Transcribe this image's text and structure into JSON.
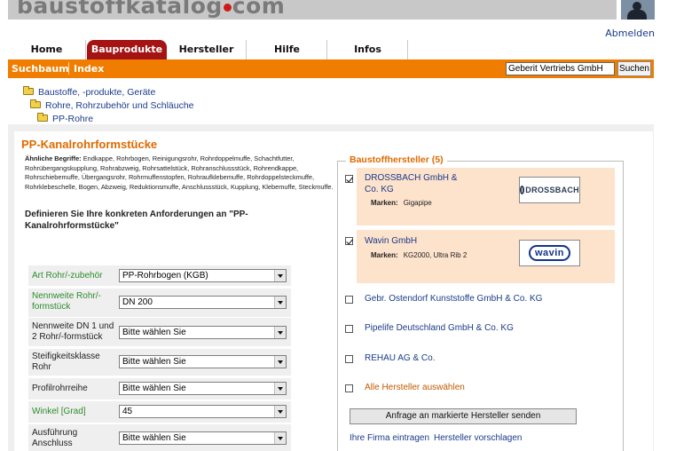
{
  "header": {
    "logo_text": "baustoffkatalog",
    "logo_suffix": "com",
    "logout_label": "Abmelden"
  },
  "tabs": [
    {
      "label": "Home",
      "active": false
    },
    {
      "label": "Bauprodukte",
      "active": true
    },
    {
      "label": "Hersteller",
      "active": false
    },
    {
      "label": "Hilfe",
      "active": false
    },
    {
      "label": "Infos",
      "active": false
    }
  ],
  "subnav": {
    "suchbaum": "Suchbaum",
    "index": "Index",
    "search_value": "Geberit Vertriebs GmbH",
    "search_button": "Suchen"
  },
  "breadcrumb": [
    "Baustoffe, -produkte, Geräte",
    "Rohre, Rohrzubehör und Schläuche",
    "PP-Rohre"
  ],
  "main": {
    "title": "PP-Kanalrohrformstücke",
    "similar_label": "Ähnliche Begriffe:",
    "similar_terms": "Endkappe, Rohrbogen, Reinigungsrohr, Rohrdoppelmuffe, Schachtfutter, Rohrübergangskupplung, Rohrabzweig, Rohrsattelstück, Rohranschlussstück, Rohrendkappe, Rohrschiebemuffe, Übergangsrohr, Rohrmuffenstopfen, Rohraufklebemuffe, Rohrdoppelsteckmuffe, Rohrklebeschelle, Bogen, Abzweig, Reduktionsmuffe, Anschlussstück, Kupplung, Klebemuffe, Steckmuffe.",
    "define_text": "Definieren Sie Ihre konkreten Anforderungen an \"PP-Kanalrohrformstücke\""
  },
  "filters": [
    {
      "label": "Art Rohr/-zubehör",
      "value": "PP-Rohrbogen (KGB)",
      "set": true
    },
    {
      "label": "Nennweite Rohr/-formstück",
      "value": "DN 200",
      "set": true
    },
    {
      "label": "Nennweite DN 1 und 2 Rohr/-formstück",
      "value": "Bitte wählen Sie",
      "set": false
    },
    {
      "label": "Steifigkeitsklasse Rohr",
      "value": "Bitte wählen Sie",
      "set": false
    },
    {
      "label": "Profilrohrreihe",
      "value": "Bitte wählen Sie",
      "set": false
    },
    {
      "label": "Winkel [Grad]",
      "value": "45",
      "set": true
    },
    {
      "label": "Ausführung Anschluss",
      "value": "Bitte wählen Sie",
      "set": false
    }
  ],
  "manufacturers": {
    "heading": "Baustoffhersteller (5)",
    "marken_label": "Marken:",
    "items": [
      {
        "name": "DROSSBACH GmbH & Co. KG",
        "checked": true,
        "marken": "Gigapipe",
        "logo": "DROSSBACH"
      },
      {
        "name": "Wavin GmbH",
        "checked": true,
        "marken": "KG2000, Ultra Rib 2",
        "logo": "wavin"
      },
      {
        "name": "Gebr. Ostendorf Kunststoffe GmbH & Co. KG",
        "checked": false
      },
      {
        "name": "Pipelife Deutschland GmbH & Co. KG",
        "checked": false
      },
      {
        "name": "REHAU AG & Co.",
        "checked": false
      }
    ],
    "select_all": "Alle Hersteller auswählen",
    "send_button": "Anfrage an markierte Hersteller senden",
    "footer_links": [
      "Ihre Firma eintragen",
      "Hersteller vorschlagen"
    ]
  },
  "colors": {
    "accent_orange": "#f07d00",
    "active_tab": "#a51414",
    "title_orange": "#e06a00",
    "link_blue": "#1a3a8a",
    "label_green": "#2e8b2e",
    "highlight_box": "#fde2cc"
  }
}
